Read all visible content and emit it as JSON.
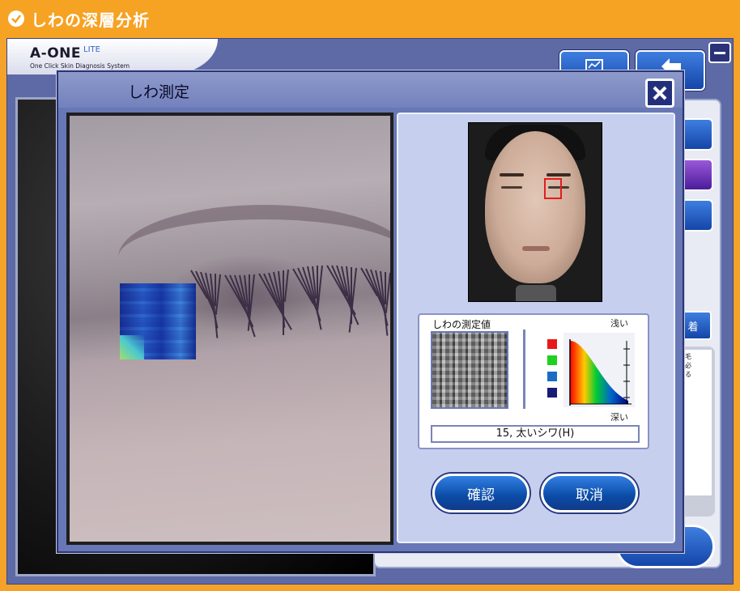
{
  "header": {
    "title": "しわの深層分析"
  },
  "app": {
    "logo_main": "A-ONE",
    "logo_lite": "LITE",
    "logo_sub": "One Click Skin Diagnosis System",
    "side_label": "着",
    "note_lines": [
      "た毛",
      "が必",
      "する"
    ]
  },
  "dialog": {
    "title": "しわ測定",
    "measure_label": "しわの測定値",
    "shallow_label": "浅い",
    "deep_label": "深い",
    "value": "15, 太いシワ(H)",
    "confirm_label": "確認",
    "cancel_label": "取消",
    "legend_colors": [
      "#e81919",
      "#1fd11f",
      "#1b6cc2",
      "#1a1a78"
    ]
  },
  "colors": {
    "titlebar": "#f6a223",
    "app_bg": "#5e6aa6",
    "dialog_bg": "#6877b5",
    "panel_bg": "#c6d0ee",
    "button_blue": "#0a4ba6",
    "marker_red": "#e01e1e"
  }
}
